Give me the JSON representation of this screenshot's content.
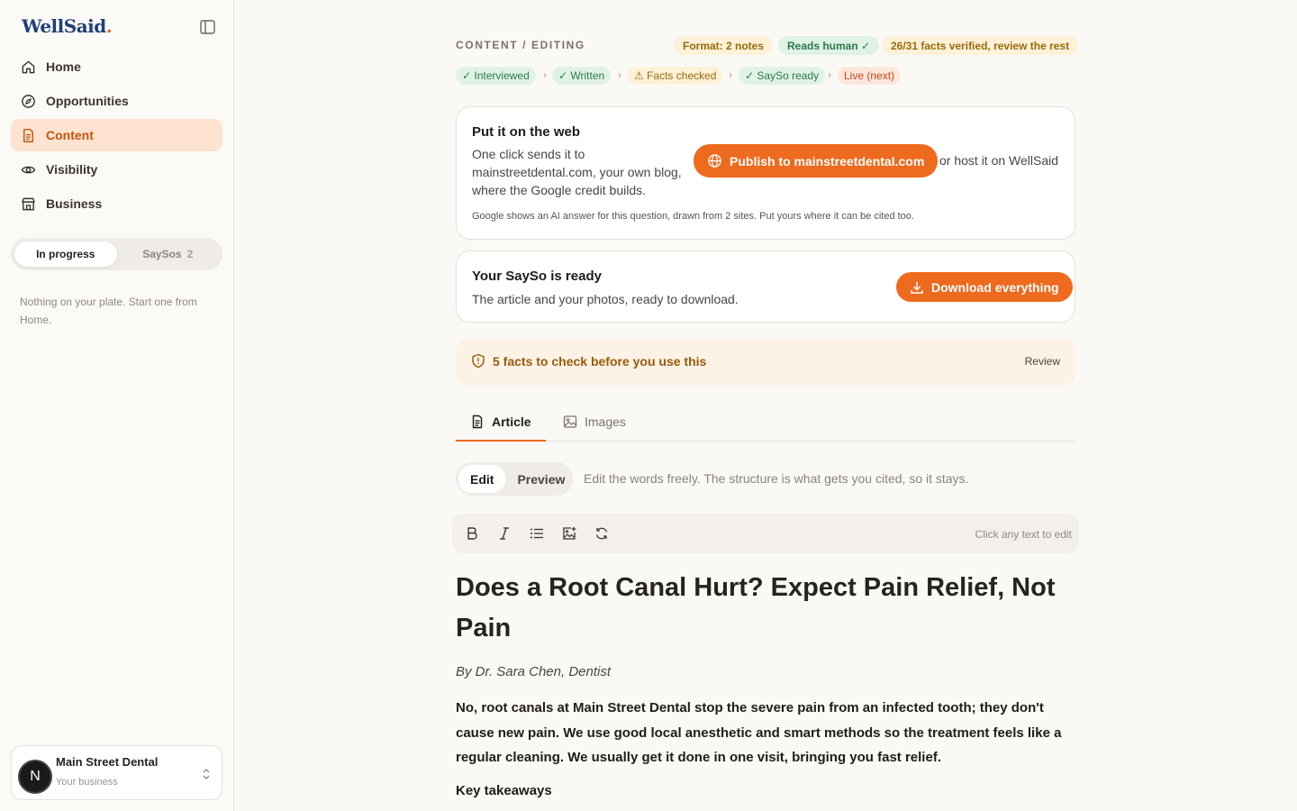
{
  "app": {
    "logo": "WellSaid",
    "logo_dot": "."
  },
  "sidebar": {
    "nav": [
      {
        "label": "Home",
        "icon": "home-icon"
      },
      {
        "label": "Opportunities",
        "icon": "compass-icon"
      },
      {
        "label": "Content",
        "icon": "document-icon",
        "active": true
      },
      {
        "label": "Visibility",
        "icon": "eye-icon"
      },
      {
        "label": "Business",
        "icon": "store-icon"
      }
    ],
    "segment": {
      "in_progress": "In progress",
      "saysos": "SaySos",
      "saysos_count": "2"
    },
    "empty_message": "Nothing on your plate. Start one from Home.",
    "business": {
      "avatar_letter": "N",
      "name": "Main Street Dental",
      "subtitle": "Your business"
    }
  },
  "header": {
    "breadcrumb": "CONTENT / EDITING",
    "badges": {
      "format": "Format: 2 notes",
      "reads_human": "Reads human ✓",
      "facts": "26/31 facts verified, review the rest"
    },
    "steps": [
      {
        "label": "✓ Interviewed",
        "state": "done"
      },
      {
        "label": "✓ Written",
        "state": "done"
      },
      {
        "label": "⚠ Facts checked",
        "state": "warn"
      },
      {
        "label": "✓ SaySo ready",
        "state": "done"
      },
      {
        "label": "Live (next)",
        "state": "next"
      }
    ],
    "step_separator": "›"
  },
  "publish_card": {
    "title": "Put it on the web",
    "text": "One click sends it to mainstreetdental.com, your own blog, where the Google credit builds.",
    "button": "Publish to mainstreetdental.com",
    "alt_link": "or host it on WellSaid",
    "note": "Google shows an AI answer for this question, drawn from 2 sites. Put yours where it can be cited too."
  },
  "sayso_card": {
    "title": "Your SaySo is ready",
    "text": "The article and your photos, ready to download.",
    "button": "Download everything"
  },
  "facts_bar": {
    "label": "5 facts to check before you use this",
    "action": "Review"
  },
  "tabs": {
    "article": "Article",
    "images": "Images"
  },
  "editor": {
    "mode_edit": "Edit",
    "mode_preview": "Preview",
    "mode_hint": "Edit the words freely. The structure is what gets you cited, so it stays.",
    "toolbar_hint": "Click any text to edit"
  },
  "article": {
    "title": "Does a Root Canal Hurt? Expect Pain Relief, Not Pain",
    "byline": "By Dr. Sara Chen, Dentist",
    "lede": "No, root canals at Main Street Dental stop the severe pain from an infected tooth; they don't cause new pain. We use good local anesthetic and smart methods so the treatment feels like a regular cleaning. We usually get it done in one visit, bringing you fast relief.",
    "subhead": "Key takeaways"
  },
  "colors": {
    "accent": "#ee6a1f",
    "brand_navy": "#1f3f78",
    "success": "#2b7a4b",
    "warning": "#9a6a0a"
  }
}
